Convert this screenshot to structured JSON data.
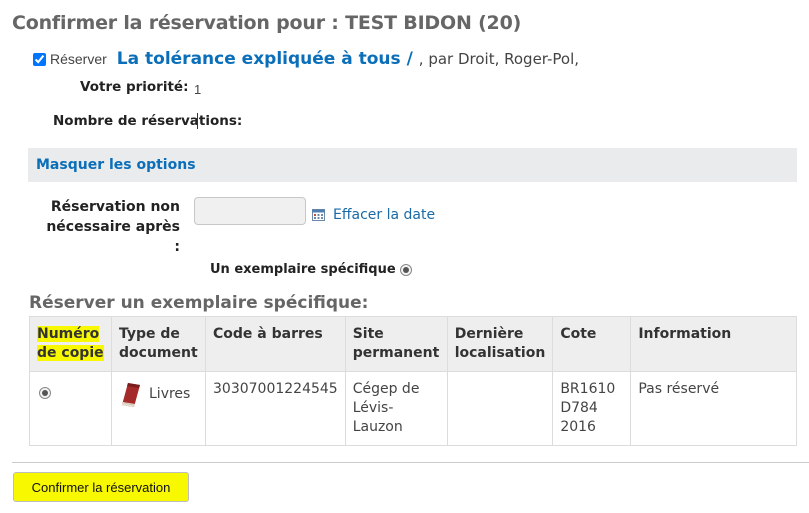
{
  "page": {
    "title": "Confirmer la réservation pour : TEST BIDON (20)"
  },
  "hold": {
    "reserve_label": "Réserver",
    "reserve_checked": true,
    "book_title": "La tolérance expliquée à tous /",
    "by_author": ", par Droit, Roger-Pol,",
    "priority_label": "Votre priorité:",
    "priority_value": "1",
    "holds_count_label": "Nombre de réservations:",
    "holds_count_value": ""
  },
  "options": {
    "toggle_label": "Masquer les options",
    "date_label_line1": "Réservation non",
    "date_label_line2": "nécessaire après :",
    "date_value": "",
    "calendar_icon": "calendar-icon",
    "clear_date_label": "Effacer la date",
    "specific_item_label": "Un exemplaire spécifique",
    "specific_item_selected": true
  },
  "item_table": {
    "heading": "Réserver un exemplaire spécifique:",
    "columns": {
      "copy_number": [
        "Numéro",
        "de copie"
      ],
      "doc_type": [
        "Type de",
        "document"
      ],
      "barcode": "Code à barres",
      "home_library": [
        "Site",
        "permanent"
      ],
      "last_location": [
        "Dernière",
        "localisation"
      ],
      "callnumber": "Cote",
      "information": "Information"
    },
    "rows": [
      {
        "selected": true,
        "doc_type_icon": "book-icon",
        "doc_type": "Livres",
        "barcode": "30307001224545",
        "home_library": [
          "Cégep de",
          "Lévis-Lauzon"
        ],
        "last_location": "",
        "callnumber": [
          "BR1610",
          "D784 2016"
        ],
        "information": "Pas réservé"
      }
    ]
  },
  "footer": {
    "confirm_label": "Confirmer la réservation"
  },
  "colors": {
    "link": "#0a6eb8",
    "highlight": "#f8f800",
    "heading_gray": "#666666",
    "options_bar": "#e9ebec"
  }
}
